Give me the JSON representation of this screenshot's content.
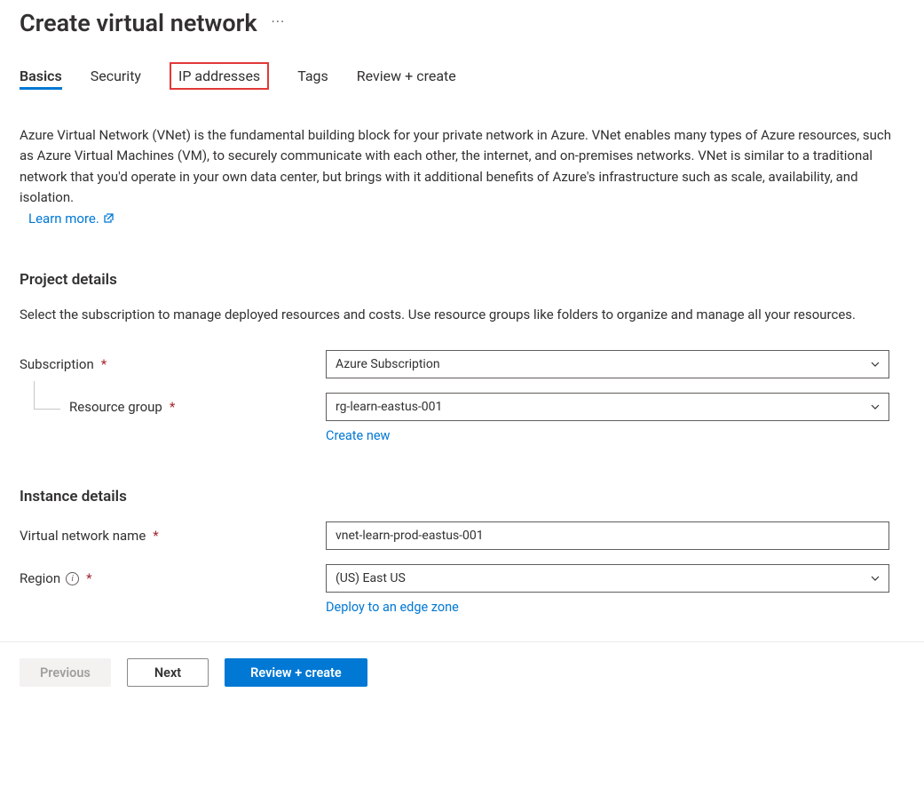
{
  "header": {
    "title": "Create virtual network"
  },
  "tabs": {
    "basics": "Basics",
    "security": "Security",
    "ip_addresses": "IP addresses",
    "tags": "Tags",
    "review_create": "Review + create"
  },
  "intro": {
    "text": "Azure Virtual Network (VNet) is the fundamental building block for your private network in Azure. VNet enables many types of Azure resources, such as Azure Virtual Machines (VM), to securely communicate with each other, the internet, and on-premises networks. VNet is similar to a traditional network that you'd operate in your own data center, but brings with it additional benefits of Azure's infrastructure such as scale, availability, and isolation.",
    "learn_more": "Learn more."
  },
  "project_details": {
    "heading": "Project details",
    "desc": "Select the subscription to manage deployed resources and costs. Use resource groups like folders to organize and manage all your resources.",
    "subscription_label": "Subscription",
    "subscription_value": "Azure Subscription",
    "resource_group_label": "Resource group",
    "resource_group_value": "rg-learn-eastus-001",
    "create_new": "Create new"
  },
  "instance_details": {
    "heading": "Instance details",
    "vnet_name_label": "Virtual network name",
    "vnet_name_value": "vnet-learn-prod-eastus-001",
    "region_label": "Region",
    "region_value": "(US) East US",
    "deploy_edge": "Deploy to an edge zone"
  },
  "footer": {
    "previous": "Previous",
    "next": "Next",
    "review_create": "Review + create"
  }
}
